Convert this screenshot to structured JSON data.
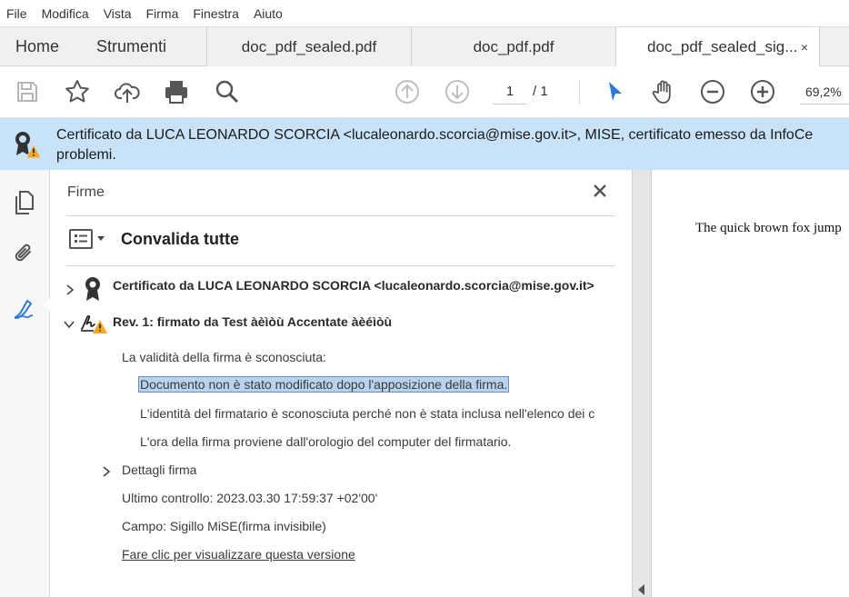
{
  "menu": {
    "items": [
      "File",
      "Modifica",
      "Vista",
      "Firma",
      "Finestra",
      "Aiuto"
    ]
  },
  "tabs": {
    "home": "Home",
    "tools": "Strumenti",
    "documents": [
      {
        "label": "doc_pdf_sealed.pdf"
      },
      {
        "label": "doc_pdf.pdf"
      },
      {
        "label": "doc_pdf_sealed_sig..."
      }
    ],
    "close_glyph": "×"
  },
  "toolbar": {
    "page_current": "1",
    "page_total": "/ 1",
    "zoom": "69,2%",
    "icons": [
      "save-icon",
      "star-icon",
      "upload-icon",
      "print-icon",
      "search-icon",
      "arrow-up-icon",
      "arrow-down-icon",
      "cursor-icon",
      "hand-icon",
      "zoom-out-icon",
      "zoom-in-icon"
    ],
    "accent": "#2b7bd6"
  },
  "infobar": {
    "line1": "Certificato da LUCA LEONARDO SCORCIA <lucaleonardo.scorcia@mise.gov.it>, MISE, certificato emesso da InfoCe",
    "line2": "problemi.",
    "background": "#c8e3f8"
  },
  "panel": {
    "title": "Firme",
    "validate_all": "Convalida tutte",
    "certificate_row": "Certificato da LUCA LEONARDO SCORCIA <lucaleonardo.scorcia@mise.gov.it>",
    "revision_row": "Rev. 1: firmato da Test àèìòù Accentate àèéìòù",
    "validity_heading": "La validità della firma è sconosciuta:",
    "detail_unmodified": "Documento non è stato modificato dopo l'apposizione della firma.",
    "detail_identity": "L'identità del firmatario è sconosciuta perché non è stata inclusa nell'elenco dei c",
    "detail_time": "L'ora della firma proviene dall'orologio del computer del firmatario.",
    "signature_details": "Dettagli firma",
    "last_check": "Ultimo controllo: 2023.03.30 17:59:37 +02'00'",
    "field": "Campo: Sigillo MiSE(firma invisibile)",
    "view_version_link": "Fare clic per visualizzare questa versione"
  },
  "document": {
    "text": "The quick brown fox jump"
  }
}
